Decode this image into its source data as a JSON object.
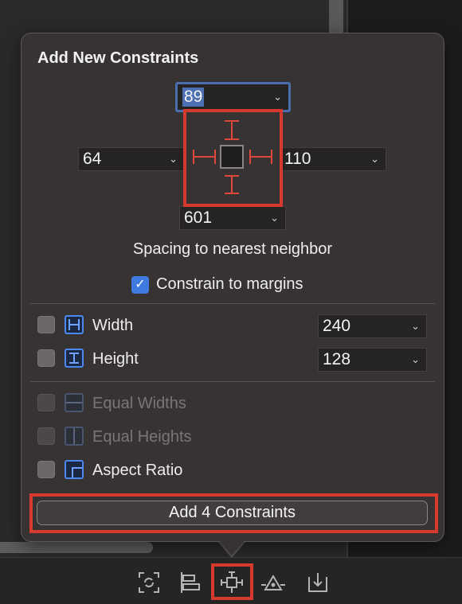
{
  "popover": {
    "title": "Add New Constraints",
    "spacing": {
      "top": "89",
      "left": "64",
      "right": "110",
      "bottom": "601"
    },
    "caption": "Spacing to nearest neighbor",
    "constrain_margins": {
      "label": "Constrain to margins",
      "checked": true
    },
    "width": {
      "label": "Width",
      "value": "240",
      "checked": false
    },
    "height": {
      "label": "Height",
      "value": "128",
      "checked": false
    },
    "equal_widths": {
      "label": "Equal Widths",
      "enabled": false
    },
    "equal_heights": {
      "label": "Equal Heights",
      "enabled": false
    },
    "aspect_ratio": {
      "label": "Aspect Ratio",
      "checked": false
    },
    "add_button": "Add 4 Constraints"
  },
  "toolbar": {
    "icons": [
      "update-frames-icon",
      "align-icon",
      "add-new-constraints-icon",
      "resolve-auto-layout-icon",
      "embed-in-icon"
    ]
  },
  "colors": {
    "accent": "#4b6eae",
    "highlight_red": "#d63a2e",
    "checkbox_blue": "#3f7ae0"
  }
}
